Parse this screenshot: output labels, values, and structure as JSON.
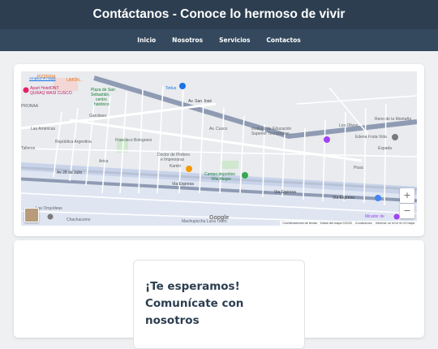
{
  "header": {
    "title": "Contáctanos - Conoce lo hermoso de vivir"
  },
  "nav": {
    "items": [
      {
        "label": "Inicio"
      },
      {
        "label": "Nosotros"
      },
      {
        "label": "Servicios"
      },
      {
        "label": "Contactos"
      }
    ]
  },
  "map": {
    "expand_link": "Ampliar el mapa",
    "google_logo": "Google",
    "zoom_in": "+",
    "zoom_out": "−",
    "attribution": [
      "Combinaciones de teclas",
      "Datos del mapa ©2025",
      "Condiciones",
      "Informar un error en el mapa"
    ],
    "labels": {
      "pizzeria": "PIZZERIA",
      "limon": "LIMÓN...",
      "apart": "Apart HotelONT",
      "wasi": "QURAQ WASI CUSCO",
      "pronaa": "PRONAA",
      "plaza1": "Plaza de San",
      "plaza2": "Sebastián,",
      "plaza3": "centro",
      "plaza4": "histórico",
      "tottus": "Tottus",
      "av_san_jose": "Av. San José",
      "garcilaso": "Garcilaso",
      "av_cusco": "Av. Cusco",
      "instituto1": "Instituto de Educación",
      "instituto2": "Superior Tecnológico...",
      "los_olivos": "Los Olivos",
      "reno": "Reno de la Montaña",
      "edena": "Edena Fruta Vida",
      "espada": "Espada",
      "las_americas": "Las Américas",
      "talleres": "Talleres",
      "republica": "República Argentina",
      "francisco": "Francisco Bolognesi",
      "doctor1": "Doctor de Plotters",
      "doctor2": "e Impresoras",
      "campo1": "Campo deportivo",
      "campo2": "Villa Alegre",
      "av28": "Av 28 de Julio",
      "via_expresa": "Via Expresa",
      "orquideas": "Las Orquídeas",
      "chachacomo": "Chachacomo",
      "machu": "Machupicchu Luna Tours",
      "mirador": "Mirador de",
      "kamiri": "Kamiri",
      "arica": "Arica",
      "pisac": "Pisac"
    }
  },
  "contact": {
    "heading": "¡Te esperamos! Comunícate con nosotros"
  }
}
